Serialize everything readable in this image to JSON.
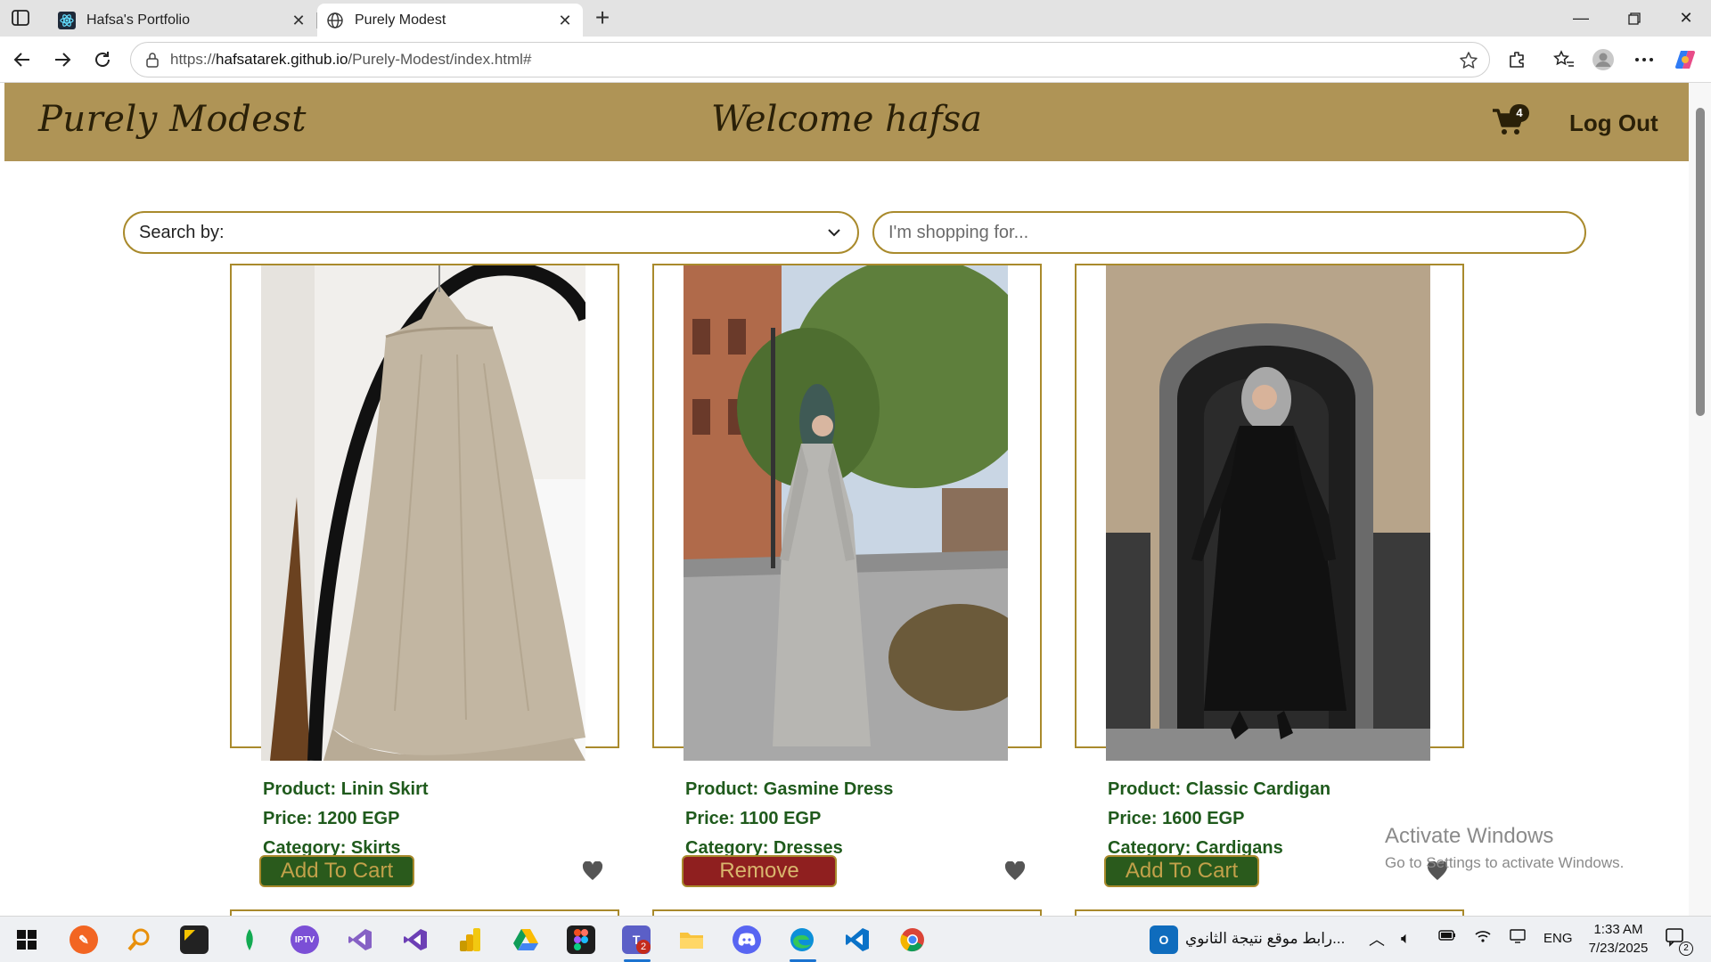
{
  "browser": {
    "tabs": [
      {
        "title": "Hafsa's Portfolio",
        "active": false
      },
      {
        "title": "Purely Modest",
        "active": true
      }
    ],
    "url_prefix": "https://",
    "url_host": "hafsatarek.github.io",
    "url_path": "/Purely-Modest/index.html#"
  },
  "site": {
    "brand": "Purely Modest",
    "welcome": "Welcome hafsa",
    "cart_count": "4",
    "logout_label": "Log Out",
    "search_by_label": "Search by:",
    "search_placeholder": "I'm shopping for..."
  },
  "products": [
    {
      "name": "Product: Linin Skirt",
      "price": "Price: 1200 EGP",
      "category": "Category: Skirts",
      "button": "Add To Cart",
      "in_cart": false
    },
    {
      "name": "Product: Gasmine Dress",
      "price": "Price: 1100 EGP",
      "category": "Category: Dresses",
      "button": "Remove",
      "in_cart": true
    },
    {
      "name": "Product: Classic Cardigan",
      "price": "Price: 1600 EGP",
      "category": "Category: Cardigans",
      "button": "Add To Cart",
      "in_cart": false
    }
  ],
  "watermark": {
    "line1": "Activate Windows",
    "line2": "Go to Settings to activate Windows."
  },
  "taskbar": {
    "notification_text": "رابط موقع نتيجة الثانوي...",
    "language": "ENG",
    "time": "1:33 AM",
    "date": "7/23/2025",
    "teams_badge": "2",
    "notification_count": "2"
  },
  "colors": {
    "header_bg": "#af9456",
    "accent_border": "#a98a2c",
    "product_text": "#1f5a1c",
    "add_button_bg": "#2a5a1c",
    "remove_button_bg": "#8f1f1f"
  }
}
